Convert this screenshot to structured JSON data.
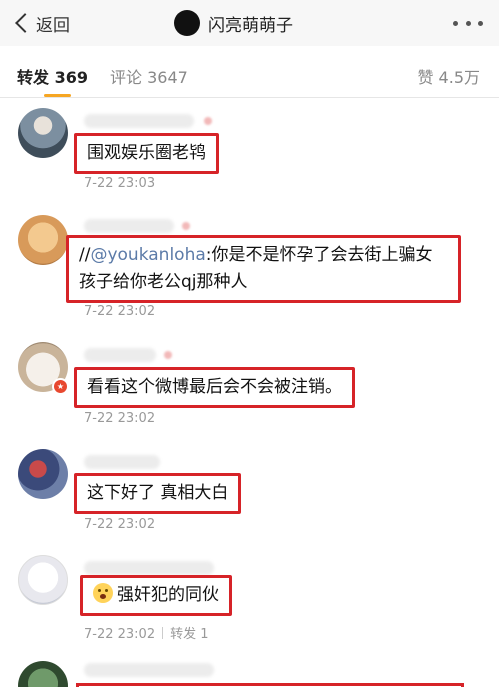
{
  "nav": {
    "back_label": "返回",
    "title": "闪亮萌萌子"
  },
  "tabs": {
    "repost_label": "转发",
    "repost_count": "369",
    "comment_label": "评论",
    "comment_count": "3647",
    "like_label": "赞",
    "like_count": "4.5万"
  },
  "reposts": [
    {
      "text": "围观娱乐圈老鸨",
      "time": "7-22 23:03"
    },
    {
      "mention": "@youkanloha",
      "prefix": "//",
      "text": ":你是不是怀孕了会去街上骗女孩子给你老公qj那种人",
      "time": "7-22 23:02"
    },
    {
      "text": "看看这个微博最后会不会被注销。",
      "time": "7-22 23:02"
    },
    {
      "text": "这下好了 真相大白",
      "time": "7-22 23:02"
    },
    {
      "emoji": "scared-emoji",
      "text": "强奸犯的同伙",
      "time": "7-22 23:02",
      "repost_label": "转发 1"
    }
  ],
  "colors": {
    "highlight_border": "#d62328",
    "tab_accent": "#f6a623",
    "mention": "#5c7ba8"
  }
}
